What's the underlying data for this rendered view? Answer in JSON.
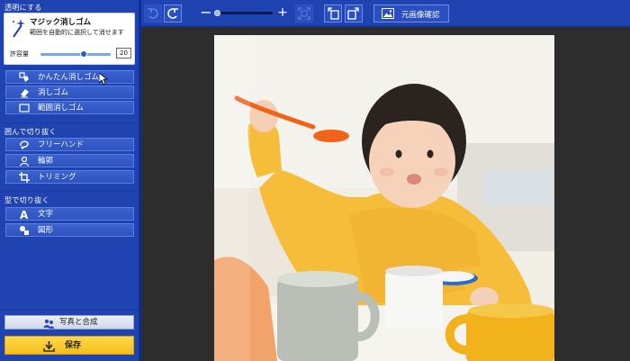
{
  "sidebar": {
    "section_transparent": "透明にする",
    "tool_card": {
      "name": "マジック消しゴム",
      "description": "範囲を自動的に選択して消せます",
      "tolerance_label": "許容量",
      "tolerance_value": "20",
      "tolerance_level_fraction": 0.62
    },
    "transparent_buttons": [
      {
        "label": "かんたん消しゴム",
        "icon": "easy-eraser-icon"
      },
      {
        "label": "消しゴム",
        "icon": "eraser-icon"
      },
      {
        "label": "範囲消しゴム",
        "icon": "rectangle-eraser-icon"
      }
    ],
    "section_enclose": "囲んで切り抜く",
    "enclose_buttons": [
      {
        "label": "フリーハンド",
        "icon": "freehand-lasso-icon"
      },
      {
        "label": "輪郭",
        "icon": "person-outline-icon"
      },
      {
        "label": "トリミング",
        "icon": "crop-icon"
      }
    ],
    "section_shape": "型で切り抜く",
    "shape_buttons": [
      {
        "label": "文字",
        "icon": "text-a-icon"
      },
      {
        "label": "図形",
        "icon": "shapes-icon"
      }
    ],
    "photo_compose_label": "写真と合成",
    "save_label": "保存"
  },
  "toolbar": {
    "zoom_level_fraction": 0.05,
    "original_check_label": "元画像確認"
  },
  "colors": {
    "panel": "#1f43b0",
    "button": "#2e53bf",
    "save": "#f5be1a",
    "canvas_bg": "#2d2d2d"
  }
}
